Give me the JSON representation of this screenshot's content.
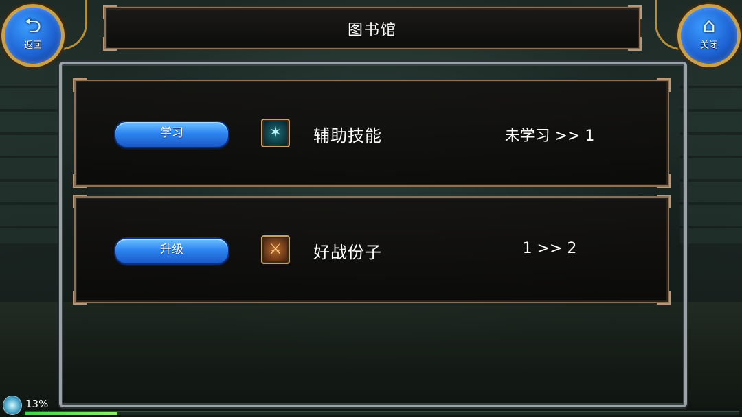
{
  "header": {
    "title": "图书馆",
    "back_label": "返回",
    "close_label": "关闭",
    "back_icon": "return-arrow-icon",
    "close_icon": "home-icon"
  },
  "skills": [
    {
      "action_label": "学习",
      "icon": "assist-skill-icon",
      "name": "辅助技能",
      "level": "未学习 >> 1"
    },
    {
      "action_label": "升级",
      "icon": "warrior-skill-icon",
      "name": "好战份子",
      "level": "1 >> 2"
    }
  ],
  "status": {
    "percent_text": "13%",
    "progress": 0.13
  },
  "colors": {
    "button_blue": "#2e86f0",
    "frame_brown": "#8a7055",
    "gold": "#c9a14a",
    "progress_green": "#3fd44a"
  }
}
